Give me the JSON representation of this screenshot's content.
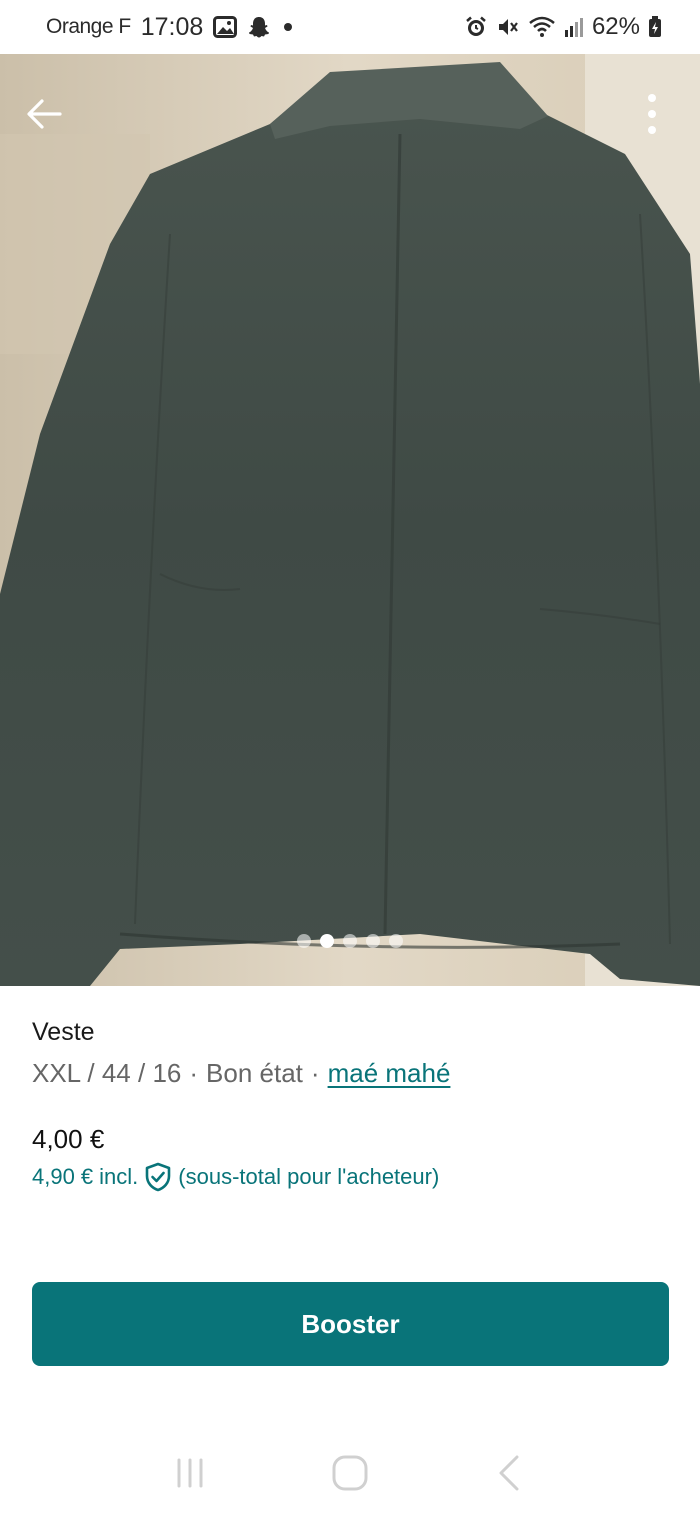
{
  "status_bar": {
    "carrier": "Orange F",
    "time": "17:08",
    "battery": "62%",
    "icons": [
      "gallery-icon",
      "snapchat-icon",
      "dot-icon",
      "alarm-icon",
      "mute-icon",
      "wifi-icon",
      "signal-icon",
      "battery-icon"
    ]
  },
  "photo": {
    "image_count": 5,
    "active_index": 1
  },
  "listing": {
    "title": "Veste",
    "size": "XXL / 44 / 16",
    "separator": "·",
    "condition": "Bon état",
    "seller": "maé mahé",
    "price": "4,00 €",
    "price_incl_amount": "4,90 €",
    "price_incl_label": "incl.",
    "price_incl_note": "(sous-total pour l'acheteur)"
  },
  "actions": {
    "booster_label": "Booster"
  },
  "colors": {
    "accent": "#097479",
    "muted_text": "#666666"
  }
}
